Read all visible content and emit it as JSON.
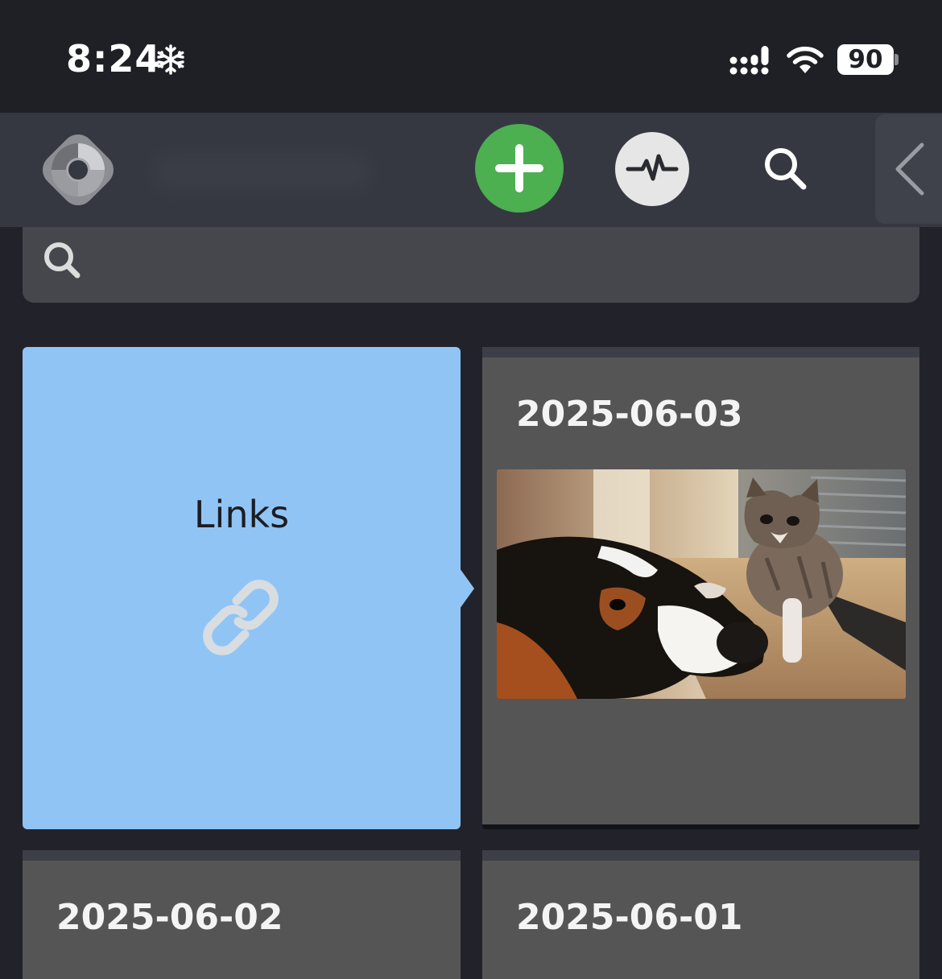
{
  "status_bar": {
    "time": "8:24",
    "battery": "90"
  },
  "toolbar": {
    "icons": [
      "app-logo-icon",
      "plus-icon",
      "activity-icon",
      "search-icon",
      "chevron-left-icon"
    ],
    "add_color": "#4caf50"
  },
  "search": {
    "value": "",
    "placeholder": ""
  },
  "cards": [
    {
      "type": "links",
      "title": "Links",
      "icon": "link-icon",
      "color": "#90c4f5"
    },
    {
      "type": "date",
      "date": "2025-06-03",
      "thumbnail": "dog-and-kitten-photo"
    },
    {
      "type": "date",
      "date": "2025-06-02"
    },
    {
      "type": "date",
      "date": "2025-06-01"
    }
  ]
}
